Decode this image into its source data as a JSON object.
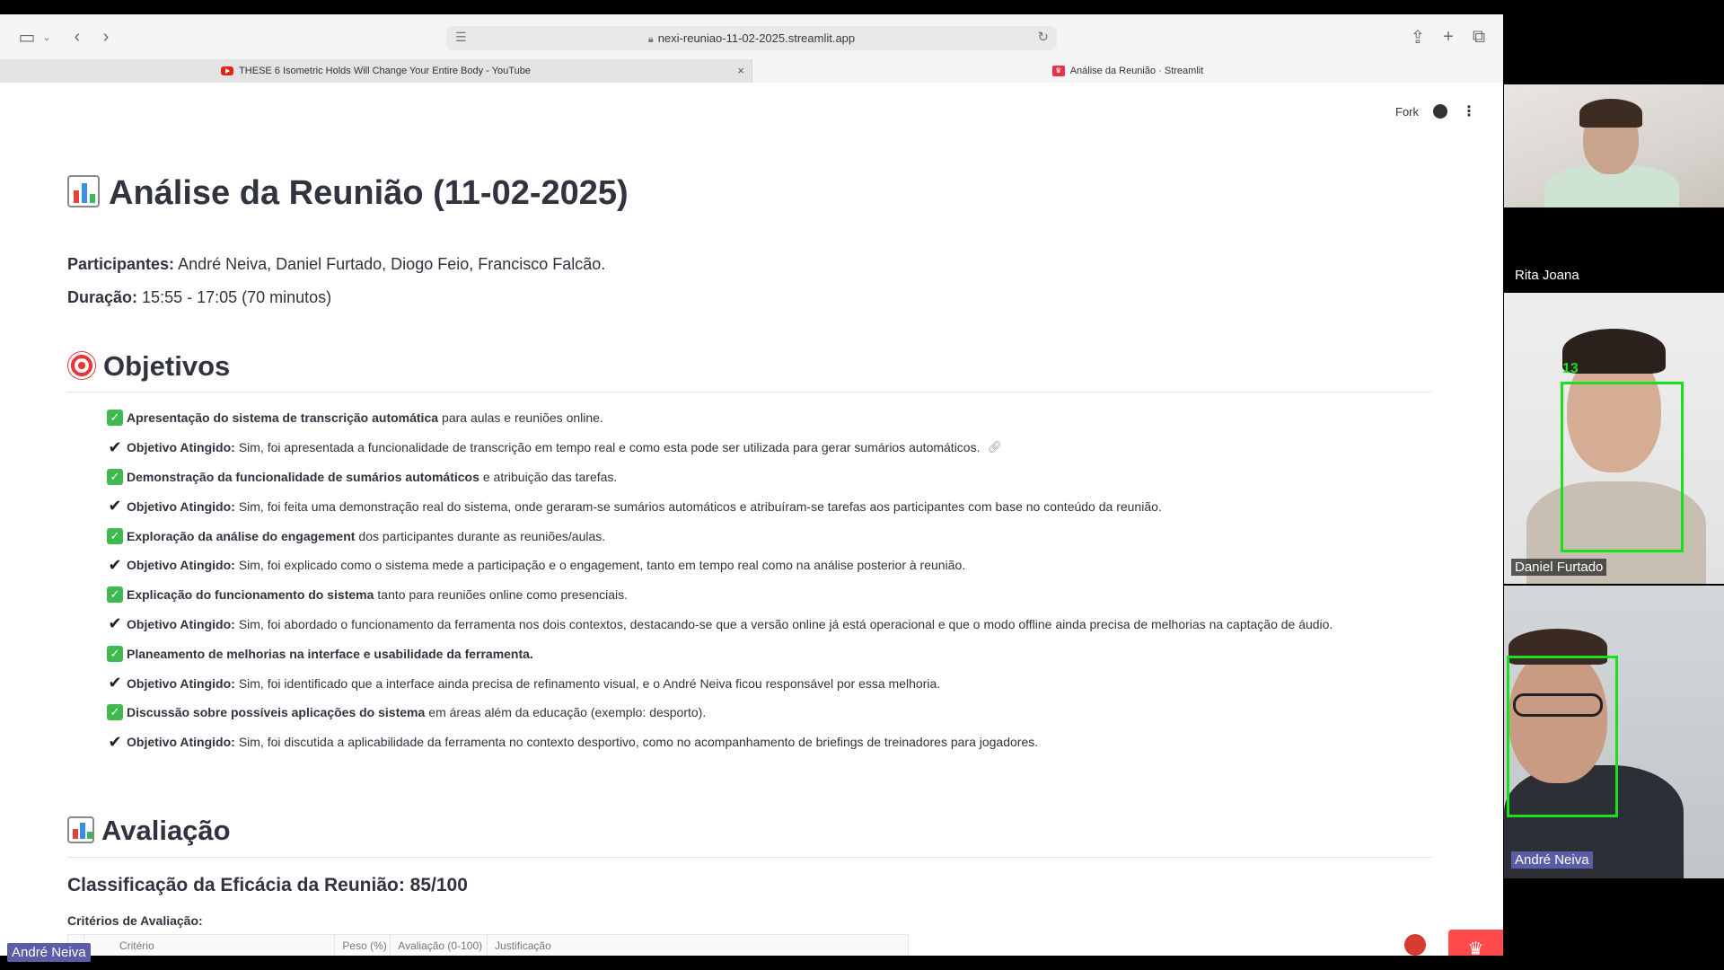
{
  "browser": {
    "url": "nexi-reuniao-11-02-2025.streamlit.app",
    "tabs": [
      {
        "title": "THESE 6 Isometric Holds Will Change Your Entire Body - YouTube",
        "close": "×"
      },
      {
        "title": "Análise da Reunião · Streamlit"
      }
    ]
  },
  "header": {
    "fork_label": "Fork"
  },
  "page": {
    "title": "Análise da Reunião (11-02-2025)",
    "participants_label": "Participantes:",
    "participants_value": "André Neiva, Daniel Furtado, Diogo Feio, Francisco Falcão.",
    "duration_label": "Duração:",
    "duration_value": "15:55 - 17:05 (70 minutos)"
  },
  "objectives": {
    "heading": "Objetivos",
    "items": [
      {
        "mark": "check",
        "bold": "Apresentação do sistema de transcrição automática",
        "text": "para aulas e reuniões online."
      },
      {
        "mark": "tick",
        "bold": "Objetivo Atingido:",
        "text": "Sim, foi apresentada a funcionalidade de transcrição em tempo real e como esta pode ser utilizada para gerar sumários automáticos."
      },
      {
        "mark": "check",
        "bold": "Demonstração da funcionalidade de sumários automáticos",
        "text": "e atribuição das tarefas."
      },
      {
        "mark": "tick",
        "bold": "Objetivo Atingido:",
        "text": "Sim, foi feita uma demonstração real do sistema, onde geraram-se sumários automáticos e atribuíram-se tarefas aos participantes com base no conteúdo da reunião."
      },
      {
        "mark": "check",
        "bold": "Exploração da análise do engagement",
        "text": "dos participantes durante as reuniões/aulas."
      },
      {
        "mark": "tick",
        "bold": "Objetivo Atingido:",
        "text": "Sim, foi explicado como o sistema mede a participação e o engagement, tanto em tempo real como na análise posterior à reunião."
      },
      {
        "mark": "check",
        "bold": "Explicação do funcionamento do sistema",
        "text": "tanto para reuniões online como presenciais."
      },
      {
        "mark": "tick",
        "bold": "Objetivo Atingido:",
        "text": "Sim, foi abordado o funcionamento da ferramenta nos dois contextos, destacando-se que a versão online já está operacional e que o modo offline ainda precisa de melhorias na captação de áudio."
      },
      {
        "mark": "check",
        "bold": "Planeamento de melhorias na interface e usabilidade da ferramenta.",
        "text": ""
      },
      {
        "mark": "tick",
        "bold": "Objetivo Atingido:",
        "text": "Sim, foi identificado que a interface ainda precisa de refinamento visual, e o André Neiva ficou responsável por essa melhoria."
      },
      {
        "mark": "check",
        "bold": "Discussão sobre possíveis aplicações do sistema",
        "text": "em áreas além da educação (exemplo: desporto)."
      },
      {
        "mark": "tick",
        "bold": "Objetivo Atingido:",
        "text": "Sim, foi discutida a aplicabilidade da ferramenta no contexto desportivo, como no acompanhamento de briefings de treinadores para jogadores."
      }
    ]
  },
  "evaluation": {
    "heading": "Avaliação",
    "score_title": "Classificação da Eficácia da Reunião: 85/100",
    "criteria_label": "Critérios de Avaliação:",
    "columns": [
      "Critério",
      "Peso (%)",
      "Avaliação (0-100)",
      "Justificação"
    ]
  },
  "call": {
    "participants": [
      "Rita Joana",
      "Daniel Furtado",
      "André Neiva"
    ],
    "face_count": "13",
    "self_name": "André Neiva"
  },
  "colors": {
    "accent": "#ff4b4b",
    "check_green": "#3fb950",
    "face_box": "#19e019",
    "name_label": "#5b5ea6"
  }
}
